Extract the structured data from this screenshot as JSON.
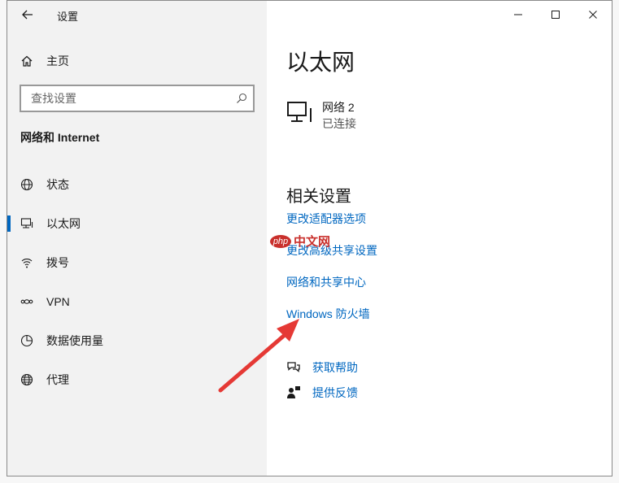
{
  "window": {
    "title": "设置",
    "controls": {
      "minimize": "minimize-icon",
      "maximize": "maximize-icon",
      "close": "close-icon"
    }
  },
  "sidebar": {
    "home_label": "主页",
    "search_placeholder": "查找设置",
    "section_title": "网络和 Internet",
    "items": [
      {
        "label": "状态",
        "icon": "globe-status-icon",
        "active": false
      },
      {
        "label": "以太网",
        "icon": "ethernet-icon",
        "active": true
      },
      {
        "label": "拨号",
        "icon": "dialup-icon",
        "active": false
      },
      {
        "label": "VPN",
        "icon": "vpn-icon",
        "active": false
      },
      {
        "label": "数据使用量",
        "icon": "data-usage-icon",
        "active": false
      },
      {
        "label": "代理",
        "icon": "proxy-globe-icon",
        "active": false
      }
    ]
  },
  "main": {
    "title": "以太网",
    "network": {
      "name": "网络 2",
      "status": "已连接"
    },
    "related_title": "相关设置",
    "links": [
      "更改适配器选项",
      "更改高级共享设置",
      "网络和共享中心",
      "Windows 防火墙"
    ],
    "help": [
      {
        "label": "获取帮助",
        "icon": "help-chat-icon"
      },
      {
        "label": "提供反馈",
        "icon": "feedback-icon"
      }
    ]
  },
  "watermark": {
    "badge": "php",
    "text": "中文网"
  },
  "colors": {
    "accent": "#0067c0",
    "arrow": "#e53935",
    "sidebar_bg": "#f2f2f2"
  }
}
